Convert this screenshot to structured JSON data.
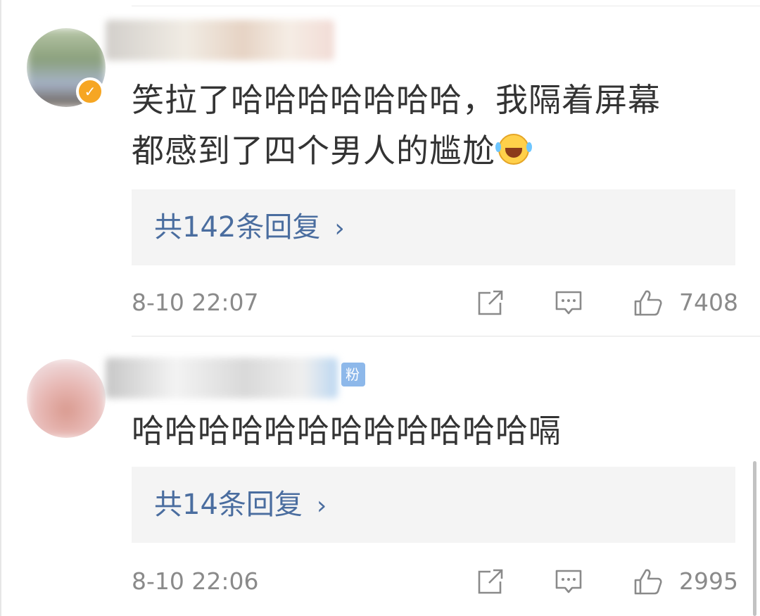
{
  "comments": [
    {
      "username_hidden": true,
      "verified": true,
      "badge_text": "",
      "text": "笑拉了哈哈哈哈哈哈哈，我隔着屏幕\n都感到了四个男人的尴尬",
      "emoji": "laughing-crying",
      "replies_label": "共142条回复",
      "timestamp": "8-10 22:07",
      "likes": "7408"
    },
    {
      "username_hidden": true,
      "verified": false,
      "badge_text": "粉",
      "text": "哈哈哈哈哈哈哈哈哈哈哈哈嗝",
      "emoji": "",
      "replies_label": "共14条回复",
      "timestamp": "8-10 22:06",
      "likes": "2995"
    }
  ],
  "icons": {
    "reply_chevron": "›",
    "verified_mark": "✓",
    "share": "share-icon",
    "comment": "comment-icon",
    "like": "thumbs-up-icon"
  },
  "colors": {
    "link": "#4a6d9f",
    "meta": "#8a8a8a",
    "reply_box": "#f4f4f4",
    "verified": "#f6a623",
    "fan_badge": "#8db8ea"
  }
}
